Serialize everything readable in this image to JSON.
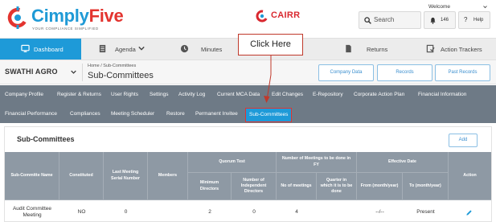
{
  "brand": {
    "name_part1": "Cimply",
    "name_part2": "Five",
    "tagline": "YOUR COMPLIANCE SIMPLIFIED",
    "secondary": "CAIRR",
    "primary_color": "#1f9ad6",
    "accent_color": "#e3342f"
  },
  "header": {
    "welcome": "Welcome",
    "search_label": "Search",
    "notifications_count": "146",
    "help_label": "Help",
    "icons": [
      "search-icon",
      "bell-icon",
      "question-icon",
      "chevron-down-icon"
    ]
  },
  "main_nav": {
    "items": [
      {
        "label": "Dashboard",
        "icon": "monitor-icon",
        "active": true
      },
      {
        "label": "Agenda",
        "icon": "document-icon",
        "active": false
      },
      {
        "label": "Minutes",
        "icon": "clock-icon",
        "active": false
      },
      {
        "label": "Returns",
        "icon": "file-icon",
        "active": false
      },
      {
        "label": "Action Trackers",
        "icon": "checklist-icon",
        "active": false
      }
    ]
  },
  "company": {
    "name": "SWATHI AGRO",
    "breadcrumb": "Home  /  Sub-Committees",
    "page_title": "Sub-Committees",
    "buttons": [
      "Company Data",
      "Records",
      "Past Records"
    ]
  },
  "sub_nav": {
    "row1": [
      "Company Profile",
      "Register & Returns",
      "User Rights",
      "Settings",
      "Activity Log",
      "Current MCA Data",
      "Edit Changes",
      "E-Repository",
      "Corporate Action Plan",
      "Financial Information"
    ],
    "row2": [
      "Financial Performance",
      "Compliances",
      "Meeting Scheduler",
      "Restore",
      "Permanent Invitee",
      "Sub-Committees"
    ],
    "active": "Sub-Committees"
  },
  "callout": {
    "text": "Click Here"
  },
  "card": {
    "title": "Sub-Committees",
    "add_label": "Add"
  },
  "table": {
    "headers": {
      "name": "Sub-Committe Name",
      "constituted": "Constituted",
      "last_meeting": "Last Meeting Serial Number",
      "members": "Members",
      "quorum_group": "Quorum Test",
      "min_directors": "Minimum Directors",
      "independent": "Number of Independent Directors",
      "meetings_group": "Number of Meetings to be done in FY",
      "no_meetings": "No of meetings",
      "quarter": "Quarter in which it is to be done",
      "effective_group": "Effective Date",
      "from": "From (month/year)",
      "to": "To (month/year)",
      "action": "Action"
    },
    "rows": [
      {
        "name": "Audit Committee Meeting",
        "constituted": "NO",
        "last_meeting": "0",
        "members": "",
        "min_directors": "2",
        "independent": "0",
        "no_meetings": "4",
        "quarter": "",
        "from": "--/--",
        "to": "Present",
        "action_icon": "pencil-icon"
      }
    ]
  }
}
